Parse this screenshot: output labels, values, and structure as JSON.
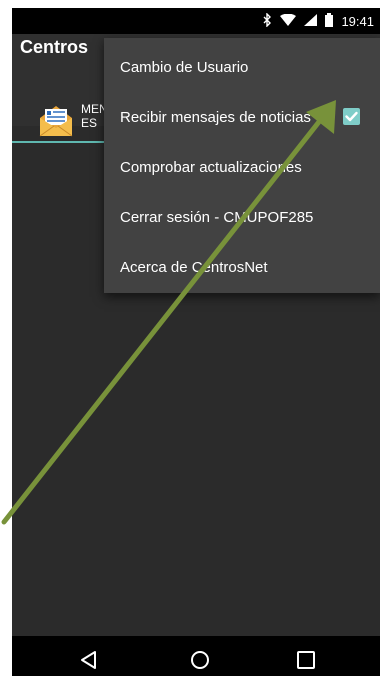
{
  "status_bar": {
    "time": "19:41"
  },
  "app_bar": {
    "title": "Centros"
  },
  "tabs": [
    {
      "label": "MENSAJES",
      "line1": "MEN",
      "line2": "ES"
    }
  ],
  "menu": {
    "items": [
      {
        "label": "Cambio de Usuario"
      },
      {
        "label": "Recibir mensajes de noticias",
        "checked": true
      },
      {
        "label": "Comprobar actualizaciones"
      },
      {
        "label": "Cerrar sesión - CMUPOF285"
      },
      {
        "label": "Acerca de CentrosNet"
      }
    ]
  },
  "colors": {
    "accent": "#7fcdc8",
    "arrow": "#78923a",
    "menu_bg": "#424242"
  }
}
